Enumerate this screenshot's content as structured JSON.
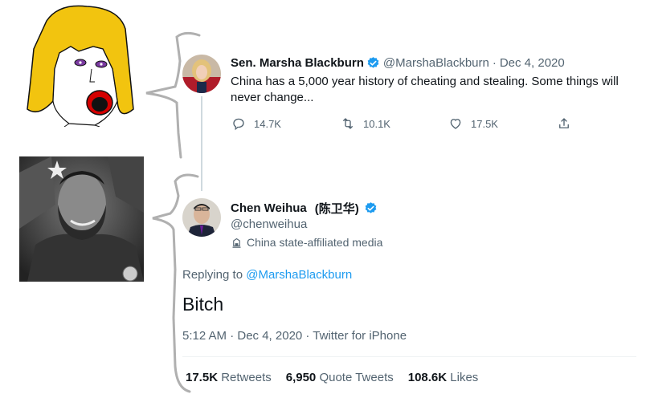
{
  "tweet1": {
    "name": "Sen. Marsha Blackburn",
    "handle": "@MarshaBlackburn",
    "separator": "·",
    "date": "Dec 4, 2020",
    "text": "China has a 5,000 year history of cheating and stealing. Some things will never change...",
    "actions": {
      "reply_count": "14.7K",
      "retweet_count": "10.1K",
      "like_count": "17.5K"
    }
  },
  "tweet2": {
    "name": "Chen Weihua",
    "name_cjk": "(陈卫华)",
    "handle": "@chenweihua",
    "label": "China state-affiliated media",
    "replying_prefix": "Replying to",
    "replying_to": "@MarshaBlackburn",
    "text": "Bitch",
    "meta": "5:12 AM · Dec 4, 2020 · Twitter for iPhone",
    "stats": {
      "retweets_count": "17.5K",
      "retweets_label": "Retweets",
      "quotes_count": "6,950",
      "quotes_label": "Quote Tweets",
      "likes_count": "108.6K",
      "likes_label": "Likes"
    }
  },
  "colors": {
    "accent": "#1d9bf0",
    "text": "#0f1419",
    "muted": "#536471",
    "wojak_hair": "#f2c40f"
  }
}
